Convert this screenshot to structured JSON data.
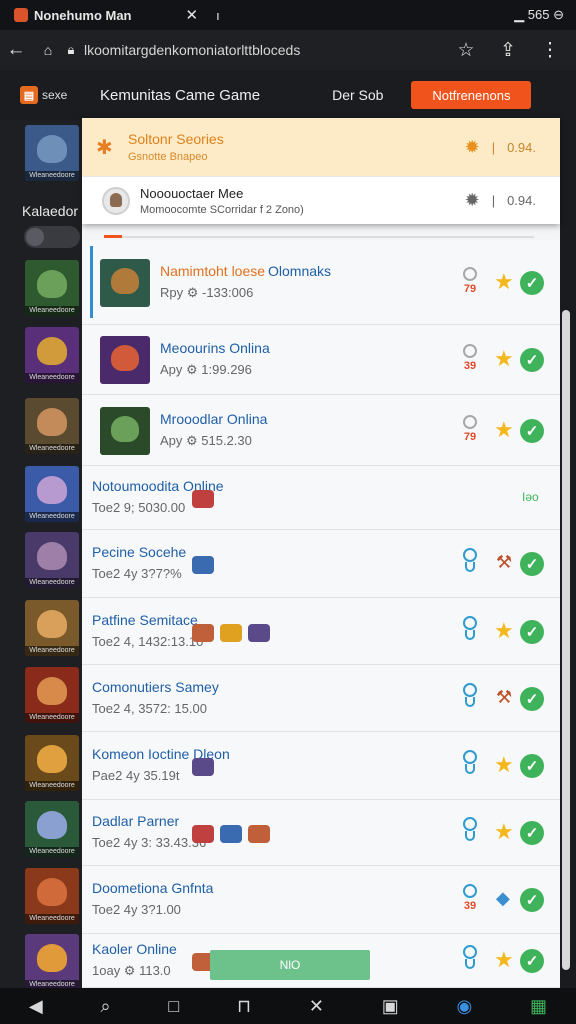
{
  "statusbar": {
    "tab_title": "Nonehumo Man",
    "close_glyph": "✕",
    "plus_glyph": "ı",
    "right_text": "▁ 565 ⊖"
  },
  "urlbar": {
    "url": "lkoomitargdenkomoniatorlttbloceds"
  },
  "header": {
    "logo_text": "sexe",
    "title": "Kemunitas Came Game",
    "login": "Der Sob",
    "notif_button": "Notfrenenons"
  },
  "sidebar": {
    "label": "Kalaedor",
    "thumbs": [
      {
        "cap": "Wleaneedoore",
        "bg": "#3b5a8a",
        "face": "#6e8fb8"
      },
      {
        "cap": "Wleaneedoore",
        "bg": "#2f5a2f",
        "face": "#6aa05a"
      },
      {
        "cap": "Wleaneedoore",
        "bg": "#5a2f7a",
        "face": "#d19a3a"
      },
      {
        "cap": "Wleaneedoore",
        "bg": "#5a4a2f",
        "face": "#c48b5a"
      },
      {
        "cap": "Wleaneedoore",
        "bg": "#3b5aa8",
        "face": "#b79ad0"
      },
      {
        "cap": "Wleaneedoore",
        "bg": "#4a3a6a",
        "face": "#9d7fa8"
      },
      {
        "cap": "Wleaneedoore",
        "bg": "#7a5a2a",
        "face": "#d8a05a"
      },
      {
        "cap": "Wleaneedoore",
        "bg": "#8a2a1a",
        "face": "#d88a4a"
      },
      {
        "cap": "Wleaneedoore",
        "bg": "#6a4a1a",
        "face": "#e0a040"
      },
      {
        "cap": "Wleaneedoore",
        "bg": "#2a5a3a",
        "face": "#8aa0d0"
      },
      {
        "cap": "Wleaneedoore",
        "bg": "#8a3a1a",
        "face": "#d06a3a"
      },
      {
        "cap": "Wleaneedoore",
        "bg": "#5a3a7a",
        "face": "#e09a3a"
      }
    ]
  },
  "dropdown": {
    "head": {
      "title": "Soltonr Seories",
      "subtitle": "Gsnotte Bnapeo",
      "right_value": "0.94."
    },
    "item": {
      "title": "Nooouoctaer Mee",
      "subtitle": "Momoocomte SCorridar f 2 Zono)",
      "right_value": "0.94."
    }
  },
  "rows": [
    {
      "title": "Namimtoht loese",
      "extra": "Olomnaks",
      "sub": "Rpy ⚙ -133:006",
      "num": "79",
      "right": "star-check"
    },
    {
      "title": "Meoourins Onlina",
      "extra": "",
      "sub": "Apy ⚙ 1:99.296",
      "num": "39",
      "right": "star-check"
    },
    {
      "title": "Mrooodlar Onlina",
      "extra": "",
      "sub": "Apy ⚙ 515.2.30",
      "num": "79",
      "right": "star-check"
    },
    {
      "title": "Notoumoodita Online",
      "extra": "",
      "sub": "Toe2 9; 5030.00",
      "num": "",
      "right": "badge",
      "badge": "Iǝo"
    },
    {
      "title": "Pecine Socehe",
      "extra": "",
      "sub": "Toe2 4y 3?7?%",
      "num": "",
      "right": "tool-check"
    },
    {
      "title": "Patfine Semitace",
      "extra": "",
      "sub": "Toe2 4, 1432:13.10",
      "num": "",
      "right": "star-check"
    },
    {
      "title": "Comonutiers Samey",
      "extra": "",
      "sub": "Toe2 4, 3572: 15.00",
      "num": "",
      "right": "tool-check"
    },
    {
      "title": "Komeon Ioctine Dleon",
      "extra": "",
      "sub": "Pae2 4y 35.19t",
      "num": "",
      "right": "star-check"
    },
    {
      "title": "Dadlar Parner",
      "extra": "",
      "sub": "Toe2 4y 3: 33.43.36",
      "num": "",
      "right": "star-check"
    },
    {
      "title": "Doometiona Gnfnta",
      "extra": "",
      "sub": "Toe2 4y 3?1.00",
      "num": "39",
      "right": "drop-check"
    },
    {
      "title": "Kaoler Online",
      "extra": "",
      "sub": "1oay ⚙ 113.0",
      "num": "",
      "right": "star-check"
    }
  ],
  "green_button": "NlO",
  "colors": {
    "accent": "#f0541c",
    "link": "#1f5fa8",
    "check": "#3fb35c",
    "star": "#f4b71c"
  }
}
